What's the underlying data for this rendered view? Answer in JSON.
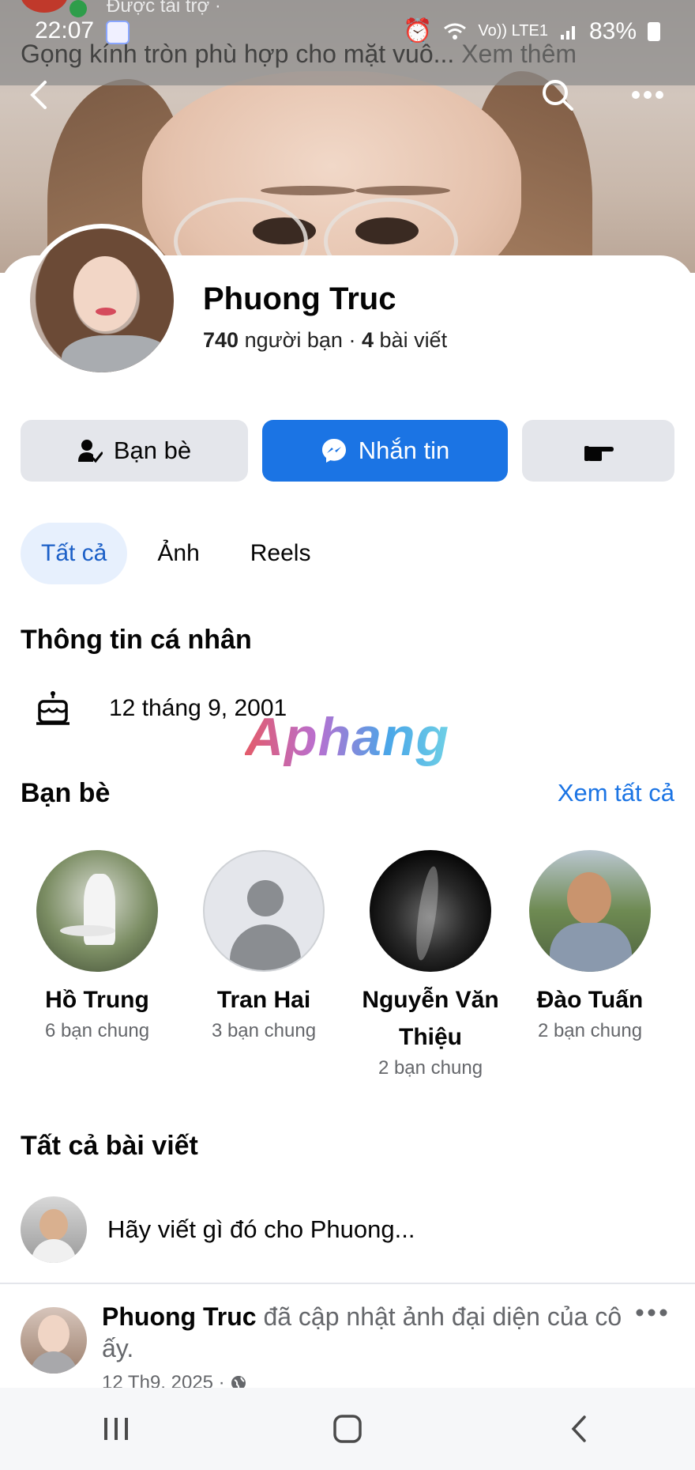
{
  "status_bar": {
    "time": "22:07",
    "battery": "83%",
    "network": "Vo)) LTE1"
  },
  "sponsored": {
    "label": "Được tài trợ ·",
    "title": "Gọng kính tròn phù hợp cho mặt vuô...",
    "see_more": "Xem thêm"
  },
  "profile": {
    "name": "Phuong Truc",
    "friends_count": "740",
    "friends_label": "người bạn",
    "separator": "·",
    "posts_count": "4",
    "posts_label": "bài viết"
  },
  "actions": {
    "friends_button": "Bạn bè",
    "message_button": "Nhắn tin"
  },
  "tabs": [
    {
      "label": "Tất cả",
      "active": true
    },
    {
      "label": "Ảnh",
      "active": false
    },
    {
      "label": "Reels",
      "active": false
    }
  ],
  "personal_info": {
    "title": "Thông tin cá nhân",
    "birthday": "12 tháng 9, 2001"
  },
  "watermark": "Aphang",
  "friends_section": {
    "title": "Bạn bè",
    "see_all": "Xem tất cả",
    "items": [
      {
        "name": "Hồ Trung",
        "mutual": "6 bạn chung"
      },
      {
        "name": "Tran Hai",
        "mutual": "3 bạn chung"
      },
      {
        "name": "Nguyễn Văn Thiệu",
        "mutual": "2 bạn chung"
      },
      {
        "name": "Đào Tuấn",
        "mutual": "2 bạn chung"
      }
    ]
  },
  "posts_section": {
    "title": "Tất cả bài viết",
    "composer_placeholder": "Hãy viết gì đó cho Phuong...",
    "post": {
      "author": "Phuong Truc",
      "action": "đã cập nhật ảnh đại diện của cô ấy.",
      "date": "12 Th9, 2025 ·"
    }
  },
  "colors": {
    "accent": "#1b74e4",
    "button_gray": "#e4e6eb",
    "tab_active_bg": "#e7f0fd"
  }
}
